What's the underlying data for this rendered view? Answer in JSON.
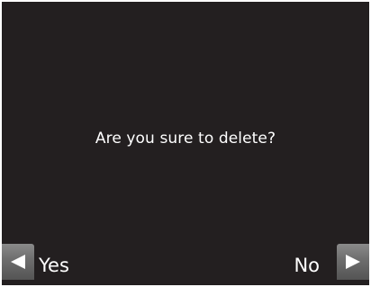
{
  "dialog": {
    "message": "Are you sure to delete?"
  },
  "softkeys": {
    "left": {
      "label": "Yes",
      "icon": "left-triangle-icon"
    },
    "right": {
      "label": "No",
      "icon": "right-triangle-icon"
    }
  },
  "colors": {
    "screen_background": "#231f20",
    "text": "#ffffff",
    "key_tab": "#6d6d6d"
  }
}
